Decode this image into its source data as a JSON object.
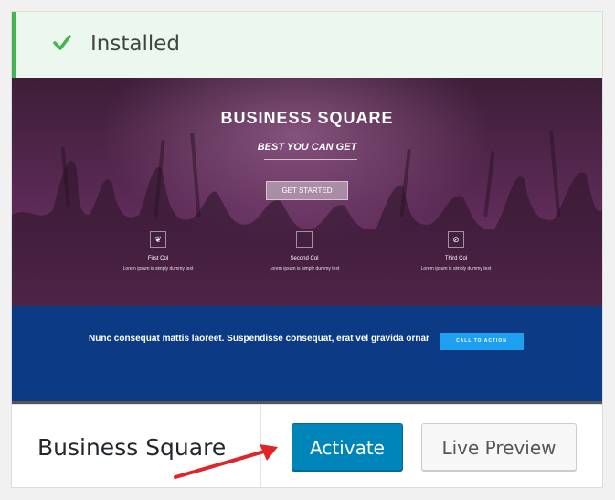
{
  "notice": {
    "text": "Installed",
    "color": "#46b450"
  },
  "screenshot": {
    "title": "BUSINESS SQUARE",
    "tagline": "BEST YOU CAN GET",
    "button": "GET STARTED",
    "columns": [
      {
        "icon": "leaf-icon",
        "glyph": "❦",
        "title": "First Col",
        "text": "Lorem ipsum is simply dummy text"
      },
      {
        "icon": "apple-icon",
        "glyph": "",
        "title": "Second Col",
        "text": "Lorem ipsum is simply dummy text"
      },
      {
        "icon": "no-entry-icon",
        "glyph": "⊘",
        "title": "Third Col",
        "text": "Lorem ipsum is simply dummy text"
      }
    ],
    "cta_text": "Nunc consequat mattis laoreet. Suspendisse consequat, erat vel gravida ornar",
    "cta_button": "CALL TO ACTION"
  },
  "theme": {
    "name": "Business Square",
    "activate_label": "Activate",
    "preview_label": "Live Preview"
  },
  "colors": {
    "accent": "#0085ba",
    "arrow": "#e0252a"
  }
}
